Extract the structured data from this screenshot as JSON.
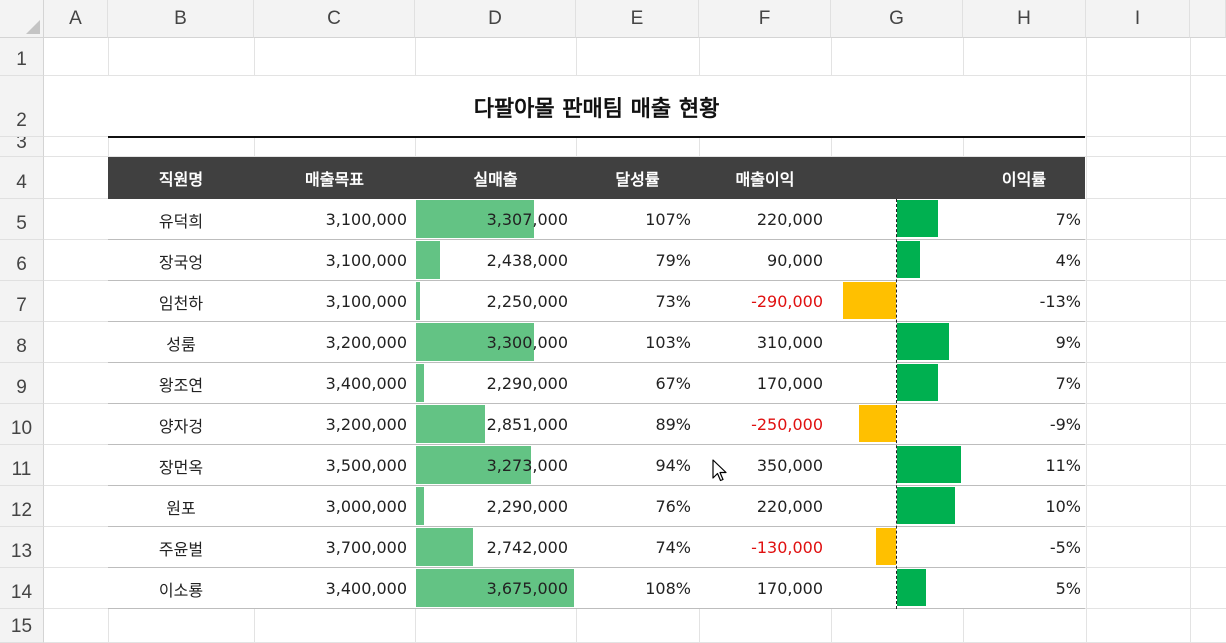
{
  "columns": [
    "A",
    "B",
    "C",
    "D",
    "E",
    "F",
    "G",
    "H",
    "I"
  ],
  "rows": [
    "1",
    "2",
    "3",
    "4",
    "5",
    "6",
    "7",
    "8",
    "9",
    "10",
    "11",
    "12",
    "13",
    "14",
    "15"
  ],
  "title": "다팔아몰 판매팀 매출 현황",
  "headers": {
    "name": "직원명",
    "target": "매출목표",
    "actual": "실매출",
    "rate": "달성률",
    "profit": "매출이익",
    "margin_chart": "",
    "margin": "이익률"
  },
  "records": [
    {
      "name": "유덕희",
      "target": "3,100,000",
      "actual": "3,307,000",
      "rate": "107%",
      "profit": "220,000",
      "margin": "7%"
    },
    {
      "name": "장국엉",
      "target": "3,100,000",
      "actual": "2,438,000",
      "rate": "79%",
      "profit": "90,000",
      "margin": "4%"
    },
    {
      "name": "임천하",
      "target": "3,100,000",
      "actual": "2,250,000",
      "rate": "73%",
      "profit": "-290,000",
      "margin": "-13%"
    },
    {
      "name": "성룸",
      "target": "3,200,000",
      "actual": "3,300,000",
      "rate": "103%",
      "profit": "310,000",
      "margin": "9%"
    },
    {
      "name": "왕조연",
      "target": "3,400,000",
      "actual": "2,290,000",
      "rate": "67%",
      "profit": "170,000",
      "margin": "7%"
    },
    {
      "name": "양자겅",
      "target": "3,200,000",
      "actual": "2,851,000",
      "rate": "89%",
      "profit": "-250,000",
      "margin": "-9%"
    },
    {
      "name": "장먼옥",
      "target": "3,500,000",
      "actual": "3,273,000",
      "rate": "94%",
      "profit": "350,000",
      "margin": "11%"
    },
    {
      "name": "원포",
      "target": "3,000,000",
      "actual": "2,290,000",
      "rate": "76%",
      "profit": "220,000",
      "margin": "10%"
    },
    {
      "name": "주윤벌",
      "target": "3,700,000",
      "actual": "2,742,000",
      "rate": "74%",
      "profit": "-130,000",
      "margin": "-5%"
    },
    {
      "name": "이소룡",
      "target": "3,400,000",
      "actual": "3,675,000",
      "rate": "108%",
      "profit": "170,000",
      "margin": "5%"
    }
  ],
  "databar_actual": {
    "min": 2250000,
    "max": 3675000,
    "color": "#63c384"
  },
  "databar_margin": {
    "pos_color": "#00b050",
    "neg_color": "#ffc000"
  },
  "icons": {
    "cursor": "mouse-pointer-icon"
  }
}
